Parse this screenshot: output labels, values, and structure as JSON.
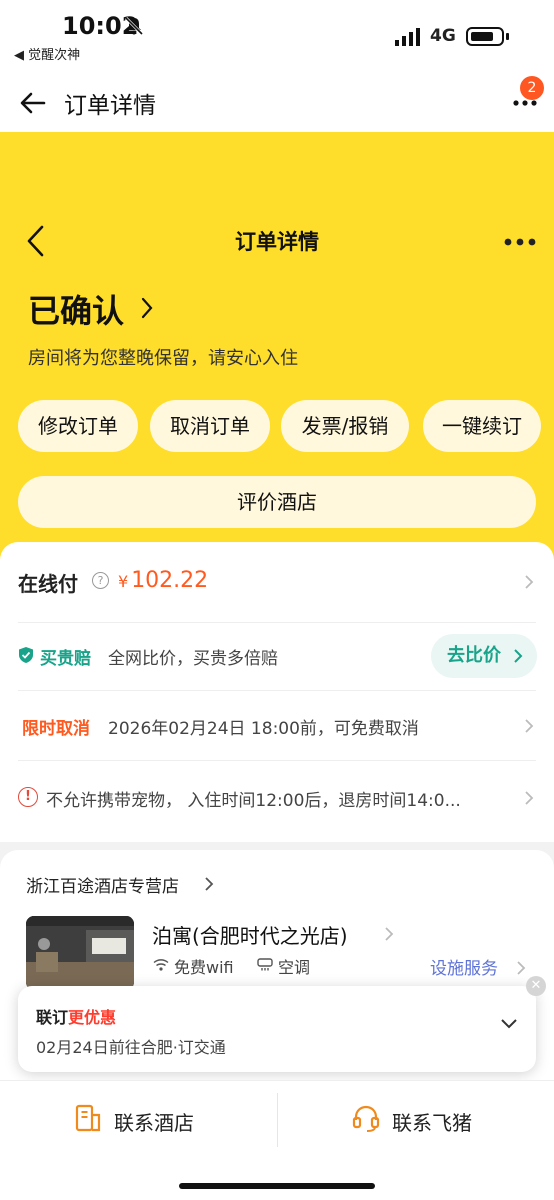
{
  "status_bar": {
    "time": "10:02",
    "back_app": "◀ 觉醒次神",
    "network": "4G"
  },
  "outer_nav": {
    "title": "订单详情",
    "badge_count": "2"
  },
  "header": {
    "title": "订单详情",
    "status": "已确认",
    "subtitle": "房间将为您整晚保留，请安心入住",
    "actions": [
      "修改订单",
      "取消订单",
      "发票/报销",
      "一键续订"
    ],
    "review_button": "评价酒店",
    "background_color": "#ffdd2b"
  },
  "payment": {
    "label": "在线付",
    "currency": "¥",
    "amount": "102.22"
  },
  "guarantee": {
    "label": "买贵赔",
    "desc": "全网比价，买贵多倍赔",
    "button": "去比价"
  },
  "cancellation": {
    "label": "限时取消",
    "desc": "2026年02月24日 18:00前，可免费取消"
  },
  "policy": {
    "desc": "不允许携带宠物， 入住时间12:00后，退房时间14:0..."
  },
  "hotel": {
    "store": "浙江百途酒店专营店",
    "name": "泊寓(合肥时代之光店)",
    "amenities": [
      {
        "icon": "wifi-icon",
        "label": "免费wifi"
      },
      {
        "icon": "air-conditioner-icon",
        "label": "空调"
      }
    ],
    "facility_link": "设施服务"
  },
  "promo": {
    "title_prefix": "联订",
    "title_highlight": "更优惠",
    "subtitle": "02月24日前往合肥·订交通"
  },
  "bottom_bar": {
    "contact_hotel": "联系酒店",
    "contact_fliggy": "联系飞猪"
  }
}
